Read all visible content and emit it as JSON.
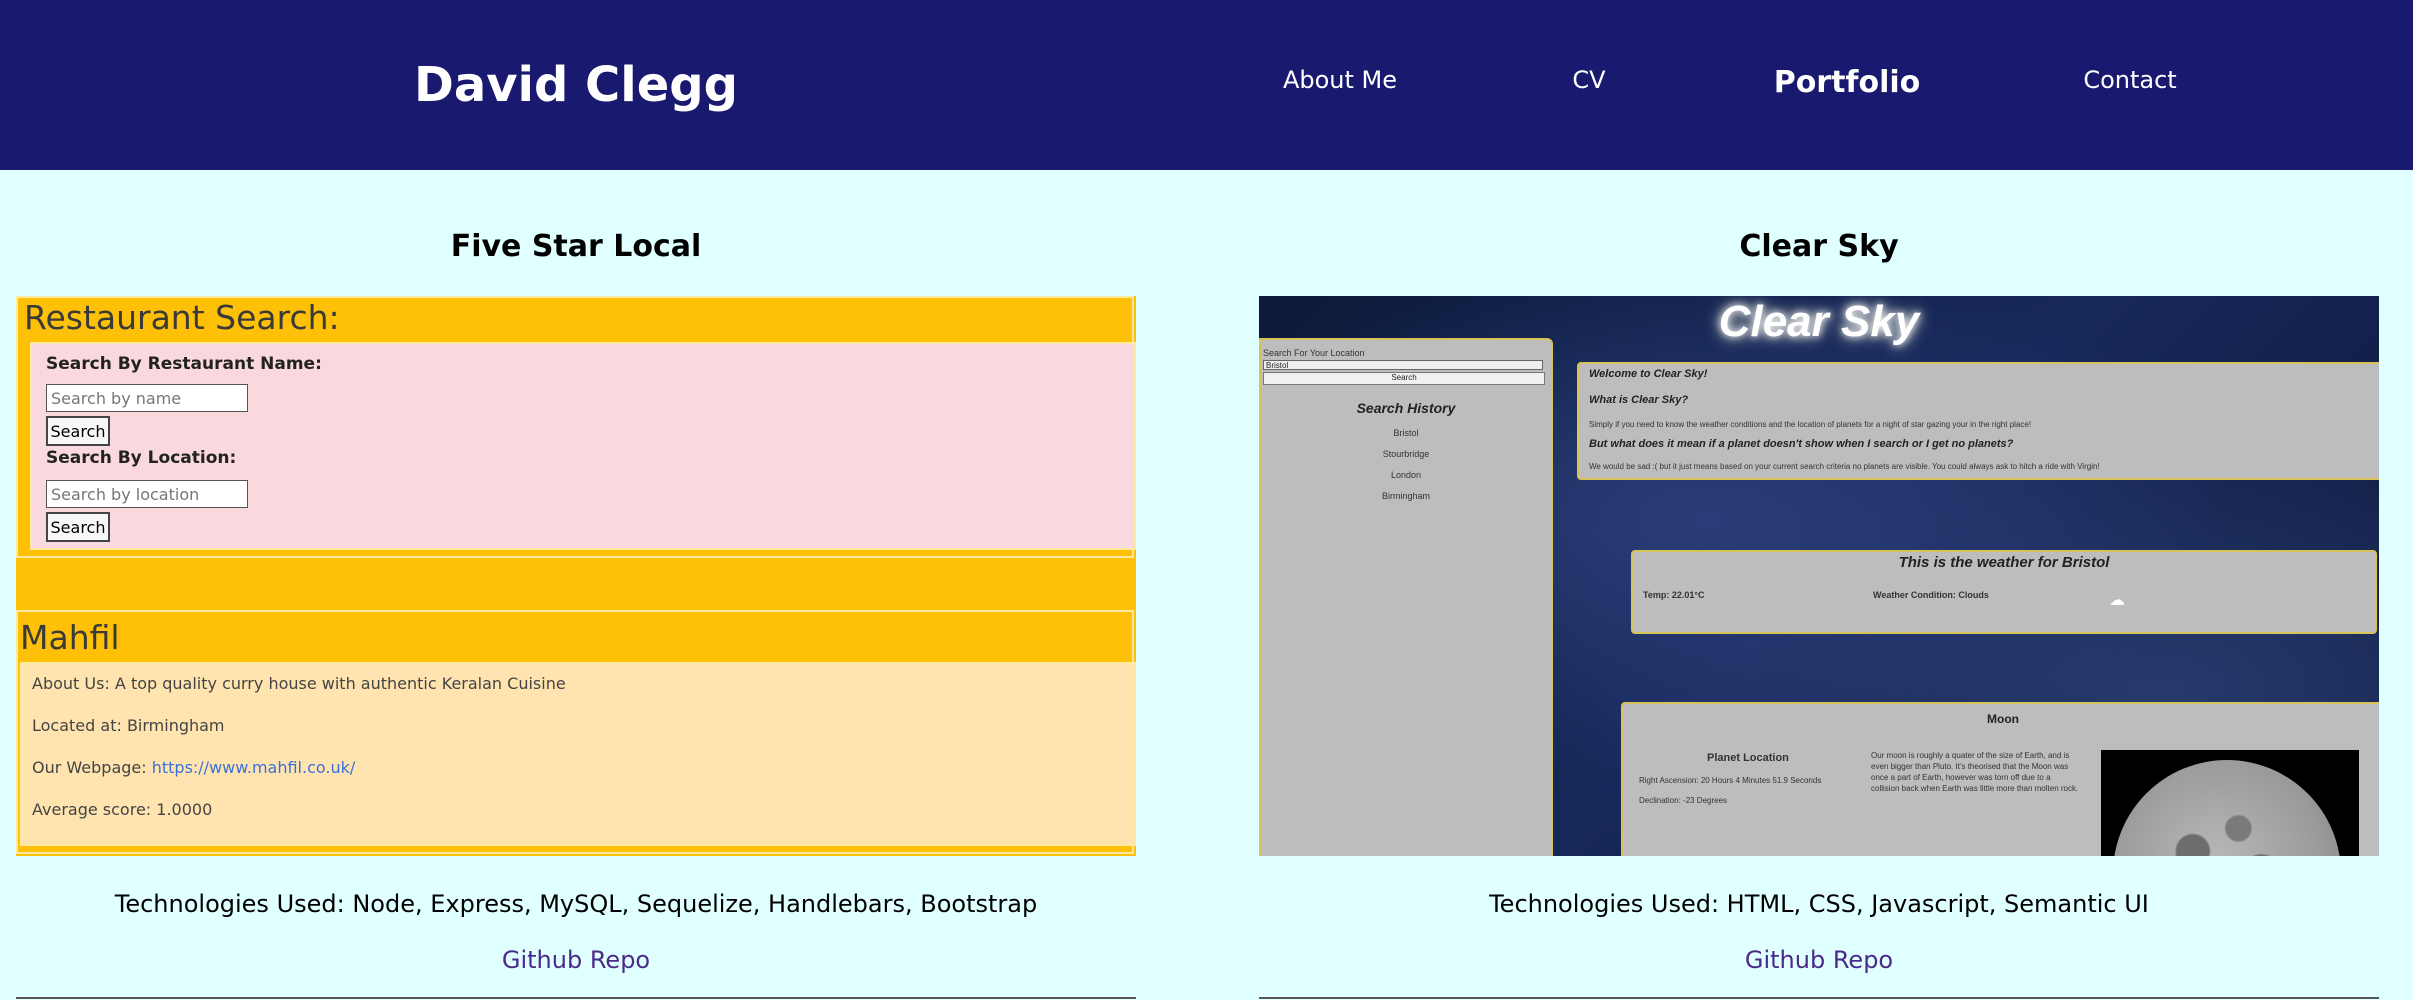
{
  "header": {
    "brand": "David Clegg",
    "nav": [
      {
        "label": "About Me"
      },
      {
        "label": "CV"
      },
      {
        "label": "Portfolio",
        "active": true
      },
      {
        "label": "Contact"
      }
    ]
  },
  "colors": {
    "header_bg": "#191970",
    "page_bg": "#e0ffff",
    "link": "#4b2a8c"
  },
  "projects": [
    {
      "title": "Five Star Local",
      "technologies": "Technologies Used: Node, Express, MySQL, Sequelize, Handlebars, Bootstrap",
      "repo_label": "Github Repo",
      "screenshot": {
        "heading": "Restaurant Search:",
        "name_label": "Search By Restaurant Name:",
        "name_placeholder": "Search by name",
        "search_btn": "Search",
        "location_label": "Search By Location:",
        "location_placeholder": "Search by location",
        "result_name": "Mahfil",
        "about": "About Us: A top quality curry house with authentic Keralan Cuisine",
        "located": "Located at: Birmingham",
        "webpage_label": "Our Webpage: ",
        "webpage_url": "https://www.mahfil.co.uk/",
        "score": "Average score: 1.0000"
      }
    },
    {
      "title": "Clear Sky",
      "technologies": "Technologies Used: HTML, CSS, Javascript, Semantic UI",
      "repo_label": "Github Repo",
      "screenshot": {
        "app_title": "Clear Sky",
        "search_label": "Search For Your Location",
        "search_value": "Bristol",
        "search_btn": "Search",
        "history_heading": "Search History",
        "history": [
          "Bristol",
          "Stourbridge",
          "London",
          "Birmingham"
        ],
        "welcome": "Welcome to Clear Sky!",
        "what_is": "What is Clear Sky?",
        "what_is_text": "Simply if you need to know the weather conditions and the location of planets for a night of star gazing your in the right place!",
        "question": "But what does it mean if a planet doesn't show when I search or I get no planets?",
        "answer": "We would be sad :( but it just means based on your current search criteria no planets are visible. You could always ask to hitch a ride with Virgin!",
        "weather_heading": "This is the weather for Bristol",
        "temp": "Temp: 22.01°C",
        "condition": "Weather Condition: Clouds",
        "moon_heading": "Moon",
        "planet_location": "Planet Location",
        "right_ascension": "Right Ascension: 20 Hours 4 Minutes 51.9 Seconds",
        "declination": "Declination: -23 Degrees",
        "moon_text": "Our moon is roughly a quater of the size of Earth, and is even bigger than Pluto. It's theorised that the Moon was once a part of Earth, however was torn off due to a collision back when Earth was little more than molten rock."
      }
    }
  ]
}
